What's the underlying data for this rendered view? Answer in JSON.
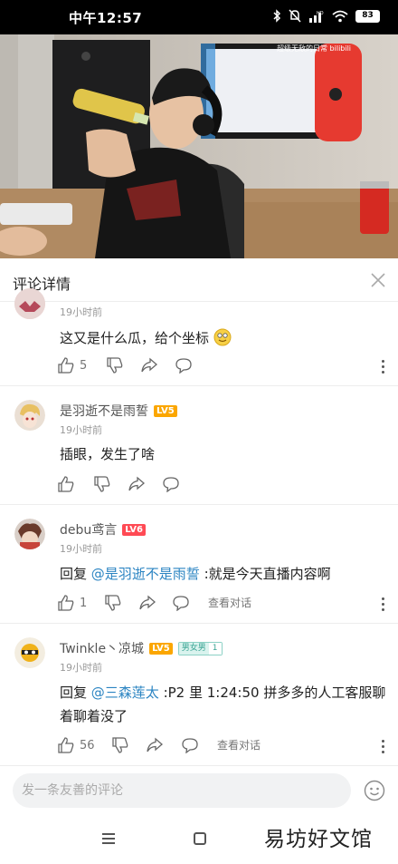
{
  "status_bar": {
    "time": "中午12:57",
    "battery": "83"
  },
  "video": {
    "overlay_text": "超级无敌的日常 bilibili"
  },
  "panel": {
    "title": "评论详情"
  },
  "comments": [
    {
      "username": "",
      "level": "",
      "time": "19小时前",
      "text": "这又是什么瓜，给个坐标",
      "likes": "5"
    },
    {
      "username": "是羽逝不是雨誓",
      "level": "LV5",
      "time": "19小时前",
      "text": "插眼，发生了啥",
      "likes": ""
    },
    {
      "username": "debu鸢言",
      "level": "LV6",
      "time": "19小时前",
      "reply_prefix": "回复 ",
      "mention": "@是羽逝不是雨誓",
      "text": " :就是今天直播内容啊",
      "likes": "1",
      "view_conversation": "查看对话"
    },
    {
      "username": "Twinkle丶凉城",
      "level": "LV5",
      "medal_name": "男女男",
      "medal_level": "1",
      "time": "19小时前",
      "reply_prefix": "回复 ",
      "mention": "@三森莲太",
      "text": " :P2 里 1:24:50  拼多多的人工客服聊着聊着没了",
      "likes": "56",
      "view_conversation": "查看对话"
    }
  ],
  "input": {
    "placeholder": "发一条友善的评论"
  },
  "watermark": "易坊好文馆"
}
